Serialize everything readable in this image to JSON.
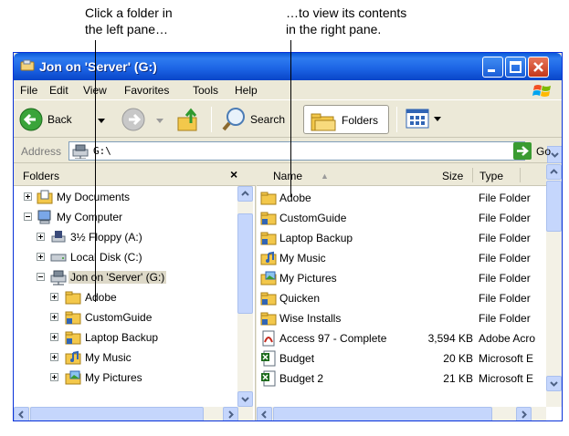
{
  "callouts": {
    "left_line1": "Click a folder in",
    "left_line2": "the left pane…",
    "right_line1": "…to view its contents",
    "right_line2": "in the right pane."
  },
  "window": {
    "title": "Jon on 'Server' (G:)"
  },
  "menu": [
    "File",
    "Edit",
    "View",
    "Favorites",
    "Tools",
    "Help"
  ],
  "toolbar": {
    "back": "Back",
    "search": "Search",
    "folders": "Folders"
  },
  "address": {
    "label": "Address",
    "value": "G:\\",
    "go": "Go"
  },
  "folders_pane": {
    "title": "Folders",
    "close": "×",
    "items": [
      {
        "label": "My Documents",
        "icon": "my-documents-icon"
      },
      {
        "label": "My Computer",
        "icon": "my-computer-icon"
      },
      {
        "label": "3½ Floppy (A:)",
        "icon": "floppy-drive-icon"
      },
      {
        "label": "Local Disk (C:)",
        "icon": "hard-disk-icon"
      },
      {
        "label": "Jon on 'Server' (G:)",
        "icon": "network-drive-icon"
      },
      {
        "label": "Adobe",
        "icon": "folder-icon"
      },
      {
        "label": "CustomGuide",
        "icon": "folder-icon"
      },
      {
        "label": "Laptop Backup",
        "icon": "folder-icon"
      },
      {
        "label": "My Music",
        "icon": "music-folder-icon"
      },
      {
        "label": "My Pictures",
        "icon": "pictures-folder-icon"
      }
    ]
  },
  "list": {
    "columns": {
      "name": "Name",
      "sort": "▲",
      "size": "Size",
      "type": "Type"
    },
    "rows": [
      {
        "name": "Adobe",
        "size": "",
        "type": "File Folder",
        "icon": "folder-icon"
      },
      {
        "name": "CustomGuide",
        "size": "",
        "type": "File Folder",
        "icon": "folder-icon"
      },
      {
        "name": "Laptop Backup",
        "size": "",
        "type": "File Folder",
        "icon": "folder-icon"
      },
      {
        "name": "My Music",
        "size": "",
        "type": "File Folder",
        "icon": "music-folder-icon"
      },
      {
        "name": "My Pictures",
        "size": "",
        "type": "File Folder",
        "icon": "pictures-folder-icon"
      },
      {
        "name": "Quicken",
        "size": "",
        "type": "File Folder",
        "icon": "folder-icon"
      },
      {
        "name": "Wise Installs",
        "size": "",
        "type": "File Folder",
        "icon": "folder-icon"
      },
      {
        "name": "Access 97 - Complete",
        "size": "3,594 KB",
        "type": "Adobe Acro",
        "icon": "pdf-file-icon"
      },
      {
        "name": "Budget",
        "size": "20 KB",
        "type": "Microsoft E",
        "icon": "excel-file-icon"
      },
      {
        "name": "Budget 2",
        "size": "21 KB",
        "type": "Microsoft E",
        "icon": "excel-file-icon"
      }
    ]
  }
}
